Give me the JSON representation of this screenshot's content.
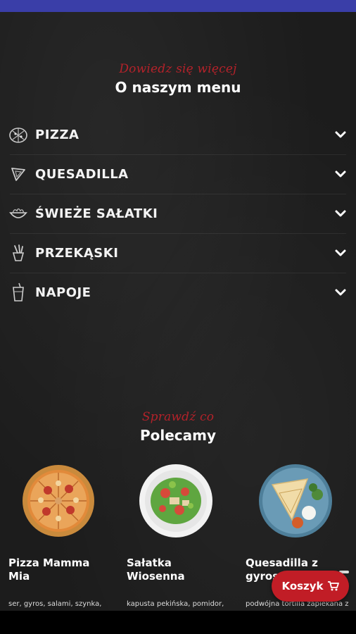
{
  "about_section": {
    "kicker": "Dowiedz się więcej",
    "title": "O naszym menu"
  },
  "menu_categories": [
    {
      "label": "PIZZA",
      "icon": "pizza-icon"
    },
    {
      "label": "QUESADILLA",
      "icon": "quesadilla-icon"
    },
    {
      "label": "ŚWIEŻE SAŁATKI",
      "icon": "salad-bowl-icon"
    },
    {
      "label": "PRZEKĄSKI",
      "icon": "snack-icon"
    },
    {
      "label": "NAPOJE",
      "icon": "drink-cup-icon"
    }
  ],
  "recommended_section": {
    "kicker": "Sprawdź co",
    "title": "Polecamy"
  },
  "recommended_items": [
    {
      "name": "Pizza Mamma Mia",
      "description": "ser, gyros, salami, szynka,"
    },
    {
      "name": "Sałatka Wiosenna",
      "description": "kapusta pekińska, pomidor,"
    },
    {
      "name": "Quesadilla z gyros",
      "description": "podwójna tortilla zapiekana z"
    }
  ],
  "cart_button": {
    "label": "Koszyk",
    "icon": "cart-icon"
  },
  "colors": {
    "accent_red": "#c11d26",
    "kicker_red": "#b3222a",
    "status_bar": "#3a3ea8",
    "background": "#1c1c1c"
  }
}
